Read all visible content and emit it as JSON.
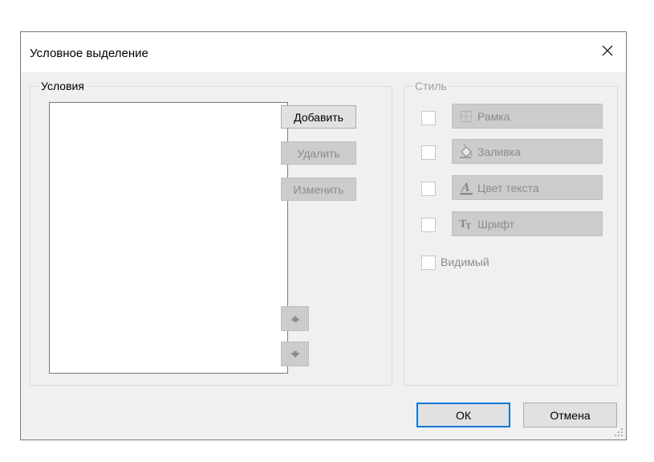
{
  "dialog": {
    "title": "Условное выделение",
    "close_icon": "close-icon"
  },
  "conditions": {
    "group_label": "Условия",
    "items": [],
    "add_label": "Добавить",
    "delete_label": "Удалить",
    "edit_label": "Изменить",
    "move_up_icon": "arrow-up-icon",
    "move_down_icon": "arrow-down-icon"
  },
  "style": {
    "group_label": "Стиль",
    "options": [
      {
        "label": "Рамка",
        "icon": "border-icon",
        "checked": false
      },
      {
        "label": "Заливка",
        "icon": "fill-bucket-icon",
        "checked": false
      },
      {
        "label": "Цвет текста",
        "icon": "text-color-icon",
        "checked": false
      },
      {
        "label": "Шрифт",
        "icon": "font-icon",
        "checked": false
      }
    ],
    "visible_label": "Видимый",
    "visible_checked": false
  },
  "footer": {
    "ok_label": "ОК",
    "cancel_label": "Отмена"
  },
  "colors": {
    "accent": "#0078d7",
    "disabled_text": "#8c8c8c",
    "dialog_bg": "#f0f0f0"
  }
}
